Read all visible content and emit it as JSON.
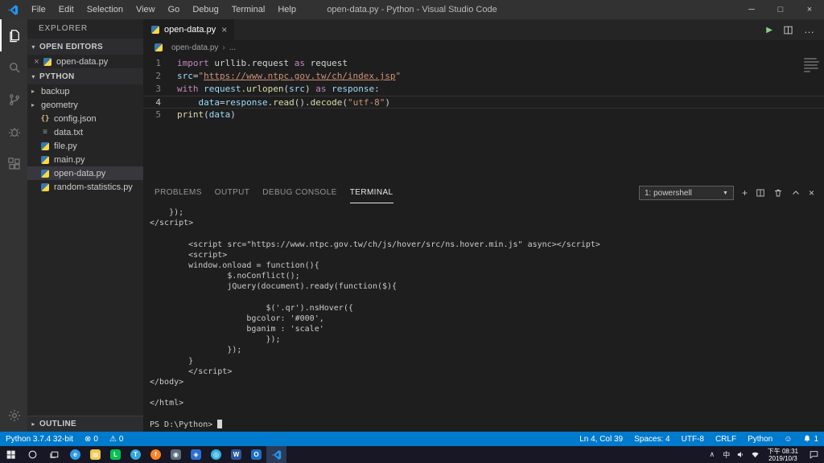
{
  "title_bar": {
    "title": "open-data.py - Python - Visual Studio Code",
    "menus": [
      "File",
      "Edit",
      "Selection",
      "View",
      "Go",
      "Debug",
      "Terminal",
      "Help"
    ]
  },
  "activity_bar": {
    "items": [
      {
        "name": "explorer",
        "icon": "files",
        "active": true
      },
      {
        "name": "search",
        "icon": "search",
        "active": false
      },
      {
        "name": "source-control",
        "icon": "source-control",
        "active": false
      },
      {
        "name": "debug",
        "icon": "debug",
        "active": false
      },
      {
        "name": "extensions",
        "icon": "extensions",
        "active": false
      }
    ],
    "bottom_items": [
      {
        "name": "manage",
        "icon": "settings",
        "active": false
      }
    ]
  },
  "sidebar": {
    "header": "EXPLORER",
    "open_editors": {
      "label": "OPEN EDITORS",
      "items": [
        {
          "label": "open-data.py",
          "icon": "python"
        }
      ]
    },
    "tree": {
      "label": "PYTHON",
      "items": [
        {
          "label": "backup",
          "icon": "folder"
        },
        {
          "label": "geometry",
          "icon": "folder"
        },
        {
          "label": "config.json",
          "icon": "json"
        },
        {
          "label": "data.txt",
          "icon": "text"
        },
        {
          "label": "file.py",
          "icon": "python"
        },
        {
          "label": "main.py",
          "icon": "python"
        },
        {
          "label": "open-data.py",
          "icon": "python",
          "selected": true
        },
        {
          "label": "random-statistics.py",
          "icon": "python"
        }
      ]
    },
    "outline": {
      "label": "OUTLINE"
    }
  },
  "editor": {
    "tabs": [
      {
        "label": "open-data.py",
        "icon": "python",
        "active": true
      }
    ],
    "breadcrumb_file": "open-data.py",
    "breadcrumb_more": "...",
    "syntax_colors": {
      "kw": "#c586c0",
      "var": "#9cdcfe",
      "fn": "#dcdcaa",
      "str": "#ce9178",
      "link": "#ce9178",
      "fg": "#d4d4d4"
    },
    "code_lines": [
      {
        "num": "1",
        "tokens": [
          [
            "import",
            "kw"
          ],
          [
            " urllib.request ",
            "fg"
          ],
          [
            "as",
            "kw"
          ],
          [
            " request",
            "fg"
          ]
        ]
      },
      {
        "num": "2",
        "tokens": [
          [
            "src",
            "var"
          ],
          [
            "=",
            "fg"
          ],
          [
            "\"",
            "str"
          ],
          [
            "https://www.ntpc.gov.tw/ch/index.jsp",
            "link"
          ],
          [
            "\"",
            "str"
          ]
        ]
      },
      {
        "num": "3",
        "tokens": [
          [
            "with",
            "kw"
          ],
          [
            " ",
            "fg"
          ],
          [
            "request",
            "var"
          ],
          [
            ".",
            "fg"
          ],
          [
            "urlopen",
            "fn"
          ],
          [
            "(",
            "fg"
          ],
          [
            "src",
            "var"
          ],
          [
            ") ",
            "fg"
          ],
          [
            "as",
            "kw"
          ],
          [
            " ",
            "fg"
          ],
          [
            "response",
            "var"
          ],
          [
            ":",
            "fg"
          ]
        ]
      },
      {
        "num": "4",
        "current": true,
        "tokens": [
          [
            "    ",
            "fg"
          ],
          [
            "data",
            "var"
          ],
          [
            "=",
            "fg"
          ],
          [
            "response",
            "var"
          ],
          [
            ".",
            "fg"
          ],
          [
            "read",
            "fn"
          ],
          [
            "().",
            "fg"
          ],
          [
            "decode",
            "fn"
          ],
          [
            "(",
            "fg"
          ],
          [
            "\"utf-8\"",
            "str"
          ],
          [
            ")",
            "fg"
          ]
        ]
      },
      {
        "num": "5",
        "tokens": [
          [
            "print",
            "fn"
          ],
          [
            "(",
            "fg"
          ],
          [
            "data",
            "var"
          ],
          [
            ")",
            "fg"
          ]
        ]
      }
    ]
  },
  "panel": {
    "tabs": [
      {
        "label": "PROBLEMS",
        "active": false
      },
      {
        "label": "OUTPUT",
        "active": false
      },
      {
        "label": "DEBUG CONSOLE",
        "active": false
      },
      {
        "label": "TERMINAL",
        "active": true
      }
    ],
    "shell_selector": "1: powershell",
    "terminal_lines": [
      "    });",
      "</script>",
      "",
      "        <script src=\"https://www.ntpc.gov.tw/ch/js/hover/src/ns.hover.min.js\" async></script>",
      "        <script>",
      "        window.onload = function(){",
      "                $.noConflict();",
      "                jQuery(document).ready(function($){",
      "",
      "                        $('.qr').nsHover({",
      "                    bgcolor: '#000',",
      "                    bganim : 'scale'",
      "                        });",
      "                });",
      "        }",
      "        </script>",
      "</body>",
      "",
      "</html>",
      ""
    ],
    "prompt": "PS D:\\Python> "
  },
  "status_bar": {
    "left_items": [
      {
        "name": "python-interpreter",
        "label": "Python 3.7.4 32-bit"
      },
      {
        "name": "errors",
        "icon": "error",
        "label": "0"
      },
      {
        "name": "warnings",
        "icon": "warning",
        "label": "0"
      }
    ],
    "right_items": [
      {
        "name": "cursor-position",
        "label": "Ln 4, Col 39"
      },
      {
        "name": "indentation",
        "label": "Spaces: 4"
      },
      {
        "name": "encoding",
        "label": "UTF-8"
      },
      {
        "name": "eol",
        "label": "CRLF"
      },
      {
        "name": "language-mode",
        "label": "Python"
      }
    ],
    "notifications_count": "1"
  },
  "taskbar": {
    "apps": [
      {
        "name": "edge",
        "color": "#2f9be9",
        "glyph": "e",
        "shape": "circle"
      },
      {
        "name": "file-explorer",
        "color": "#f0c84f",
        "glyph": "▤",
        "shape": "square"
      },
      {
        "name": "line",
        "color": "#06c152",
        "glyph": "L",
        "shape": "square"
      },
      {
        "name": "telegram",
        "color": "#31a8dd",
        "glyph": "T",
        "shape": "circle"
      },
      {
        "name": "firefox",
        "color": "#ff8324",
        "glyph": "f",
        "shape": "circle"
      },
      {
        "name": "camera",
        "color": "#5d6d7e",
        "glyph": "◉",
        "shape": "square"
      },
      {
        "name": "photos",
        "color": "#2b6fd4",
        "glyph": "◈",
        "shape": "square"
      },
      {
        "name": "maps",
        "color": "#35b2e5",
        "glyph": "◎",
        "shape": "circle"
      },
      {
        "name": "word",
        "color": "#2b579a",
        "glyph": "W",
        "shape": "square"
      },
      {
        "name": "outlook",
        "color": "#1b6fc4",
        "glyph": "O",
        "shape": "square"
      },
      {
        "name": "vscode",
        "color": "#2196f3",
        "glyph": "",
        "shape": "none",
        "active": true
      }
    ],
    "ime": "中",
    "time": "下午 08:31",
    "date": "2019/10/3"
  }
}
